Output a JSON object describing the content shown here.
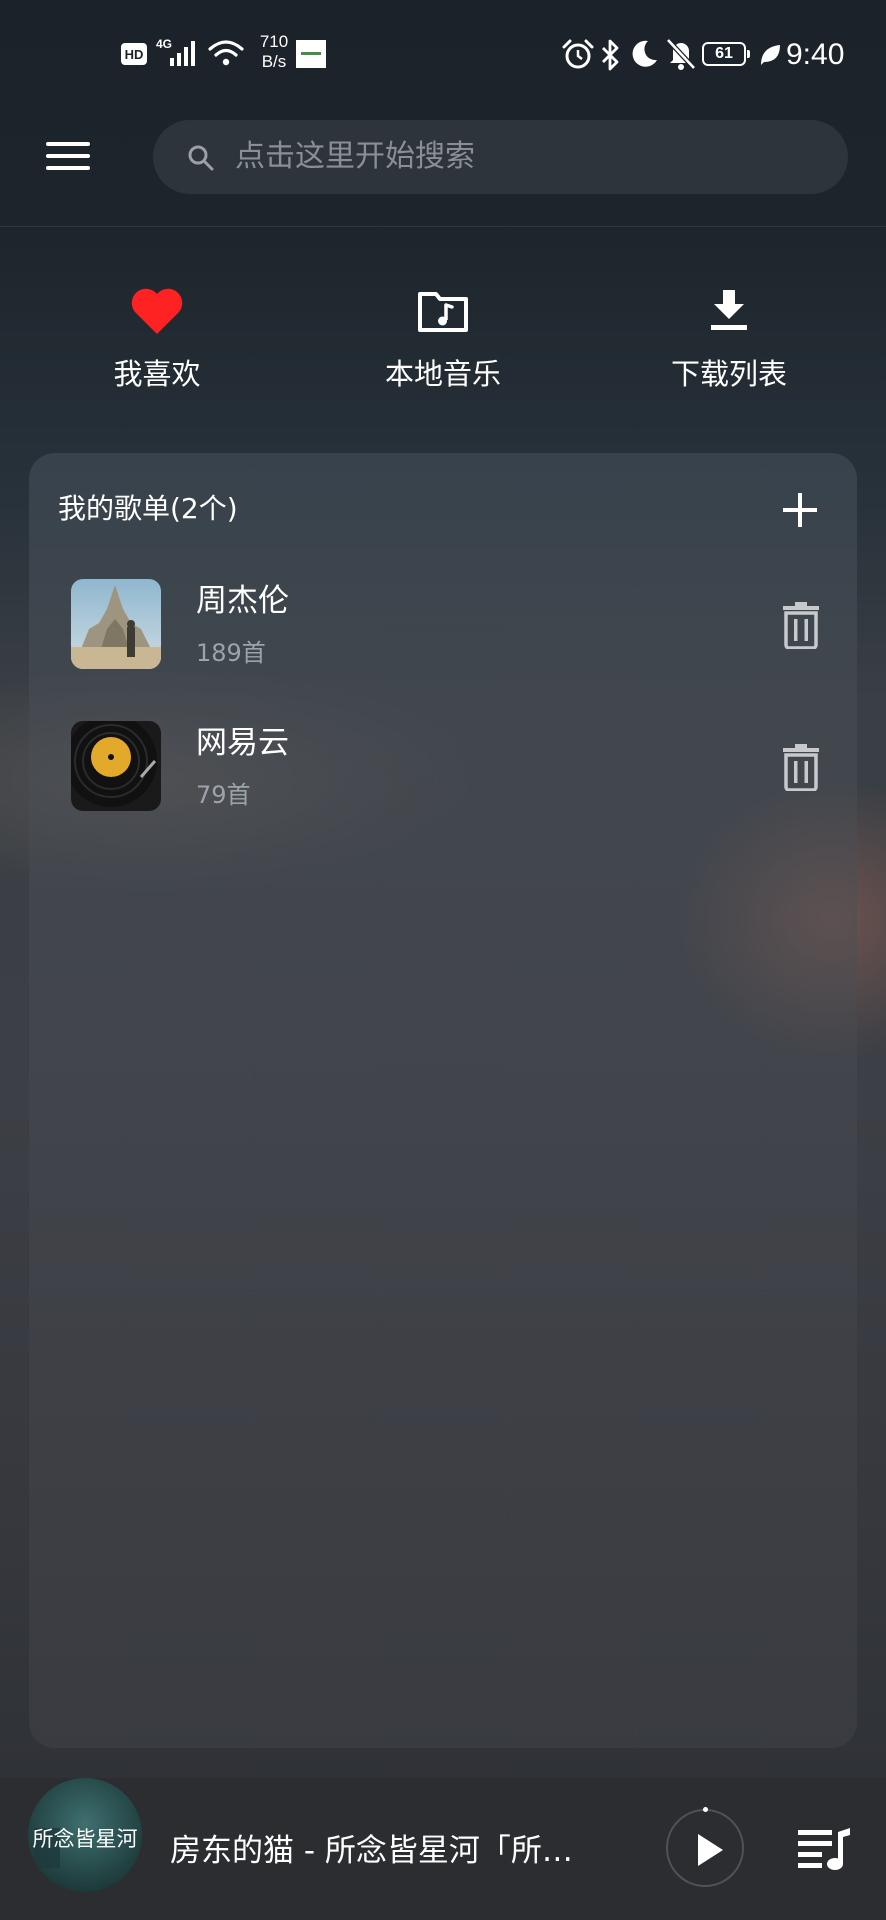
{
  "status_bar": {
    "hd_label": "HD",
    "network_label": "4G",
    "speed_value": "710",
    "speed_unit": "B/s",
    "battery_level": "61",
    "time": "9:40"
  },
  "header": {
    "search_placeholder": "点击这里开始搜索"
  },
  "quick_actions": [
    {
      "label": "我喜欢",
      "icon": "heart-icon",
      "color": "#ff2222"
    },
    {
      "label": "本地音乐",
      "icon": "music-folder-icon",
      "color": "#ffffff"
    },
    {
      "label": "下载列表",
      "icon": "download-icon",
      "color": "#ffffff"
    }
  ],
  "playlists": {
    "header": "我的歌单(2个)",
    "add_icon": "plus-icon",
    "items": [
      {
        "name": "周杰伦",
        "count": "189首",
        "thumb": "castle-photo",
        "delete_icon": "trash-icon"
      },
      {
        "name": "网易云",
        "count": "79首",
        "thumb": "vinyl-record",
        "delete_icon": "trash-icon"
      }
    ]
  },
  "player": {
    "title": "房东的猫 - 所念皆星河「所…",
    "art_text": "所念皆星河",
    "play_icon": "play-icon",
    "queue_icon": "playlist-queue-icon"
  }
}
